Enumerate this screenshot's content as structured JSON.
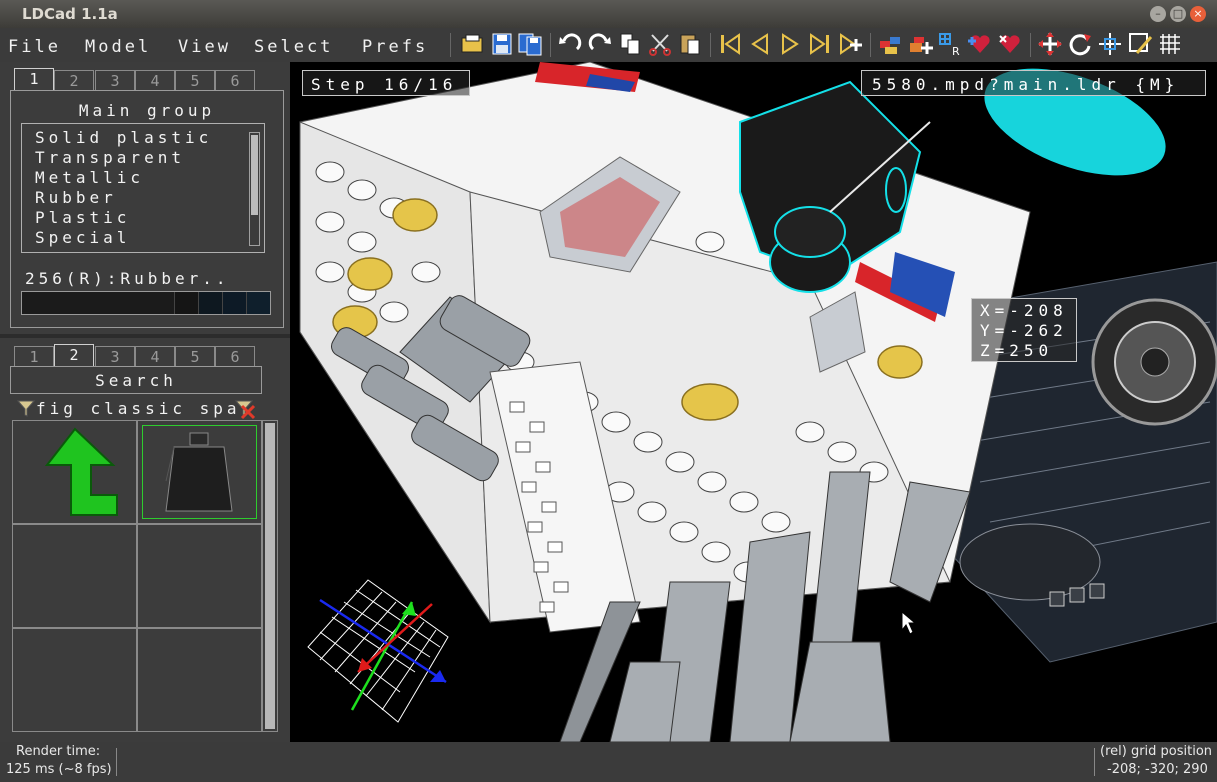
{
  "window": {
    "title": "LDCad 1.1a"
  },
  "menu": {
    "items": [
      "File",
      "Model",
      "View",
      "Select",
      "Prefs"
    ]
  },
  "toolbar": {
    "icons": [
      "open-folder-icon",
      "save-icon",
      "save-all-icon",
      "undo-icon",
      "redo-icon",
      "copy-icon",
      "cut-icon",
      "paste-icon",
      "first-step-icon",
      "prev-step-icon",
      "next-step-icon",
      "last-step-icon",
      "add-step-icon",
      "group-icon",
      "add-group-icon",
      "grid-r-icon",
      "heart-add-icon",
      "heart-remove-icon",
      "move-icon",
      "rotate-icon",
      "pan-icon",
      "edit-icon",
      "snap-grid-icon"
    ]
  },
  "color_panel": {
    "tabs": [
      "1",
      "2",
      "3",
      "4",
      "5",
      "6"
    ],
    "active_tab": "1",
    "group_title": "Main group",
    "groups": [
      "Solid plastic",
      "Transparent",
      "Metallic",
      "Rubber",
      "Plastic",
      "Special"
    ],
    "selected_color": "256(R):Rubber..",
    "swatch_colors": [
      "#1b1b1b",
      "#1b1b1b",
      "#1b1b1b",
      "#1b1b1b",
      "#1b1b1b",
      "#1b1b1b",
      "#101820",
      "#0d1a24",
      "#0e1e2a"
    ]
  },
  "parts_panel": {
    "tabs": [
      "1",
      "2",
      "3",
      "4",
      "5",
      "6"
    ],
    "active_tab": "2",
    "title": "Search",
    "filter_text": "fig classic spac",
    "items": [
      {
        "name": "up-arrow",
        "label": ""
      },
      {
        "name": "minifig-torso",
        "label": ""
      }
    ]
  },
  "viewport": {
    "step": "Step 16/16",
    "model_path": "5580.mpd?main.ldr {M}",
    "coords": {
      "x": "X=-208",
      "y": "Y=-262",
      "z": "Z=250"
    }
  },
  "status": {
    "render_label": "Render time:",
    "render_value": "125 ms (~8 fps)",
    "grid_label": "(rel) grid position",
    "grid_value": "-208; -320; 290"
  }
}
